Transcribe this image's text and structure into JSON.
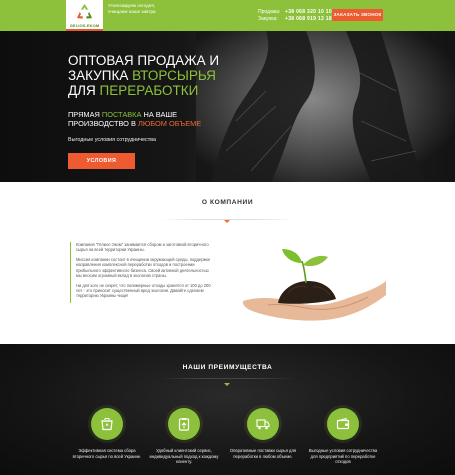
{
  "header": {
    "logo_text": "GELIOS-EKOM",
    "tagline": "Утилизируем сегодня, очищаем наше завтра",
    "phones": [
      {
        "label": "Продажа:",
        "number": "+38 068 320 10 10"
      },
      {
        "label": "Закупка:",
        "number": "+38 068 919 13 18"
      }
    ],
    "call_button": "ЗАКАЗАТЬ ЗВОНОК"
  },
  "hero": {
    "title_line1": "Оптовая продажа и",
    "title_line2a": "закупка ",
    "title_line2b": "вторсырья",
    "title_line3a": "для ",
    "title_line3b": "переработки",
    "sub_line1a": "Прямая ",
    "sub_line1b": "поставка",
    "sub_line1c": " на ваше",
    "sub_line2a": "производство в ",
    "sub_line2b": "любом объеме",
    "note": "Выгодные условия сотрудничества",
    "cta": "Условия"
  },
  "about": {
    "title": "О компании",
    "paragraphs": [
      "Компания \"Гелиос-Эком\" занимается сбором и заготовкой вторичного сырья на всей территории Украины.",
      "Миссия компании состоит в очищении окружающей среды, поддержке направления комплексной переработки отходов и построении прибыльного эффективного бизнеса. Своей активной деятельностью мы вносим огромный вклад в экологию страны.",
      "Ни для кого не секрет, что полимерные отходы хранятся от 100 до 200 лет - это приносит существенный вред экологии. Давайте сделаем территорию Украины чище!"
    ]
  },
  "advantages": {
    "title": "Наши преимущества",
    "items": [
      {
        "icon": "recycle-bin-icon",
        "text": "Эффективная система сбора вторичного сырья по всей Украине."
      },
      {
        "icon": "clipboard-icon",
        "text": "Удобный клиентский сервис, индивидуальный подход к каждому клиенту."
      },
      {
        "icon": "delivery-truck-icon",
        "text": "Оперативные поставки сырья для переработки в любом объеме."
      },
      {
        "icon": "wallet-icon",
        "text": "Выгодные условия сотрудничества для предприятий по переработке отходов"
      }
    ]
  },
  "colors": {
    "brand_green": "#8dc13c",
    "accent_orange": "#ef5b30"
  }
}
